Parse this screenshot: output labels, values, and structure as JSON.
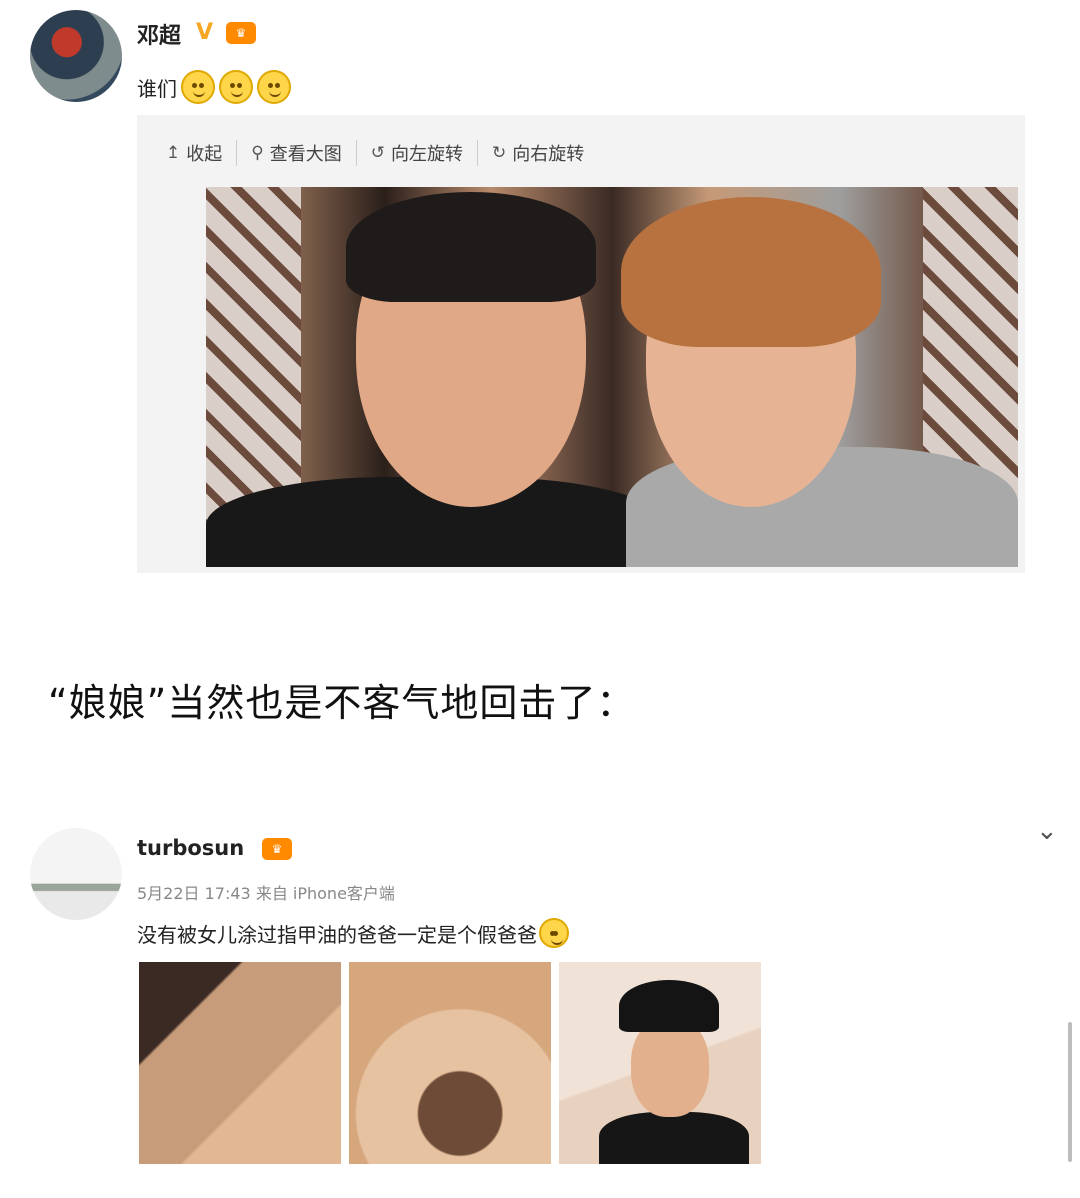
{
  "post1": {
    "username": "邓超",
    "verified_badge": "V",
    "level_badge": "lv-badge-icon",
    "text": "谁们",
    "emojis": [
      "cat-smile-emoji",
      "cat-smile-emoji",
      "cat-smile-emoji"
    ],
    "toolbar": {
      "collapse": "收起",
      "view_large": "查看大图",
      "rotate_left": "向左旋转",
      "rotate_right": "向右旋转"
    }
  },
  "caption": "“娘娘”当然也是不客气地回击了：",
  "post2": {
    "username": "turbosun",
    "level_badge": "lv-badge-icon",
    "meta": "5月22日 17:43 来自 iPhone客户端",
    "text": "没有被女儿涂过指甲油的爸爸一定是个假爸爸",
    "emoji": "grin-emoji",
    "image_count": 3
  },
  "colors": {
    "accent_orange": "#ff8a00",
    "verified_gold": "#f5a623",
    "text_dark": "#222222",
    "meta_gray": "#888888"
  }
}
